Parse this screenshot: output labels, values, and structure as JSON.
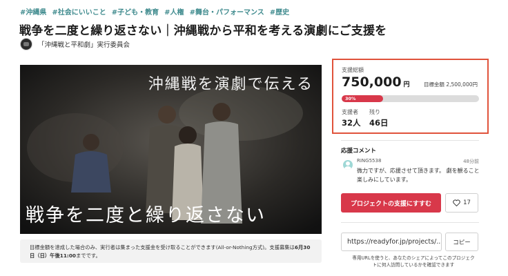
{
  "tags": [
    "#沖縄県",
    "#社会にいいこと",
    "#子ども・教育",
    "#人権",
    "#舞台・パフォーマンス",
    "#歴史"
  ],
  "title": "戦争を二度と繰り返さない｜沖縄戦から平和を考える演劇にご支援を",
  "organizer": "「沖縄戦と平和劇」実行委員会",
  "hero": {
    "caption_top": "沖縄戦を演劇で伝える",
    "caption_bottom": "戦争を二度と繰り返さない"
  },
  "note": {
    "text_before": "目標金額を達成した場合のみ、実行者は集まった支援金を受け取ることができます(All-or-Nothing方式)。支援募集は",
    "deadline": "6月30日（日）午後11:00",
    "text_after": "までです。"
  },
  "stats": {
    "total_label": "支援総額",
    "total_amount": "750,000",
    "total_unit": "円",
    "goal_text": "目標金額 2,500,000円",
    "progress_label": "30%",
    "progress_fraction": 0.3,
    "supporters_label": "支援者",
    "supporters_value": "32人",
    "remaining_label": "残り",
    "remaining_value": "46日"
  },
  "cheer": {
    "title": "応援コメント",
    "user": "RING5538",
    "time": "48分前",
    "body": "微力ですが、応援させて頂きます。 劇を観ること楽しみにしています。"
  },
  "actions": {
    "support_label": "プロジェクトの支援にすすむ",
    "like_count": "17",
    "share_url": "https://readyfor.jp/projects/...",
    "copy_label": "コピー",
    "share_note": "専用URLを使うと、あなたのシェアによってこのプロジェクトに何人訪問しているかを確認できます"
  },
  "colors": {
    "accent": "#d8384a",
    "tag": "#3e8a8d",
    "highlight_border": "#e0523a"
  }
}
